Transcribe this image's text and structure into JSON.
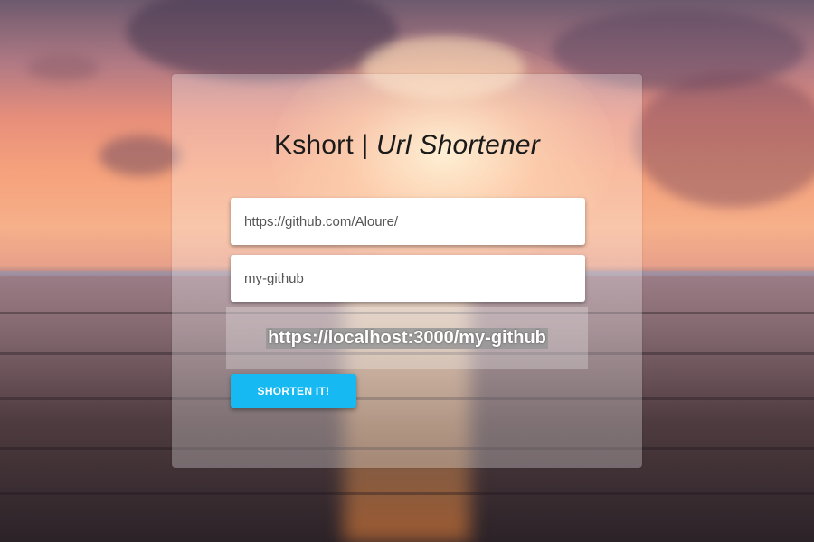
{
  "app": {
    "title_main": "Kshort",
    "title_separator": " | ",
    "title_sub": "Url Shortener"
  },
  "form": {
    "url_value": "https://github.com/Aloure/",
    "slug_value": "my-github",
    "result_url": "https://localhost:3000/my-github",
    "submit_label": "SHORTEN IT!"
  },
  "colors": {
    "button": "#17b9f2",
    "card": "rgba(255,255,255,0.28)"
  }
}
